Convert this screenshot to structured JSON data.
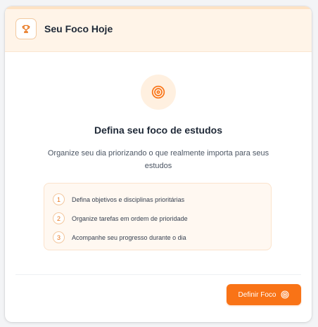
{
  "header": {
    "title": "Seu Foco Hoje",
    "icon": "trophy-icon"
  },
  "main": {
    "icon": "target-icon",
    "title": "Defina seu foco de estudos",
    "subtitle": "Organize seu dia priorizando o que realmente importa para seus estudos"
  },
  "steps": [
    {
      "number": "1",
      "text": "Defina objetivos e disciplinas prioritárias"
    },
    {
      "number": "2",
      "text": "Organize tarefas em ordem de prioridade"
    },
    {
      "number": "3",
      "text": "Acompanhe seu progresso durante o dia"
    }
  ],
  "footer": {
    "button_label": "Definir Foco",
    "button_icon": "target-icon"
  },
  "colors": {
    "accent": "#f97316",
    "header_bg": "#fff4e8",
    "steps_bg": "#fff8f1"
  }
}
